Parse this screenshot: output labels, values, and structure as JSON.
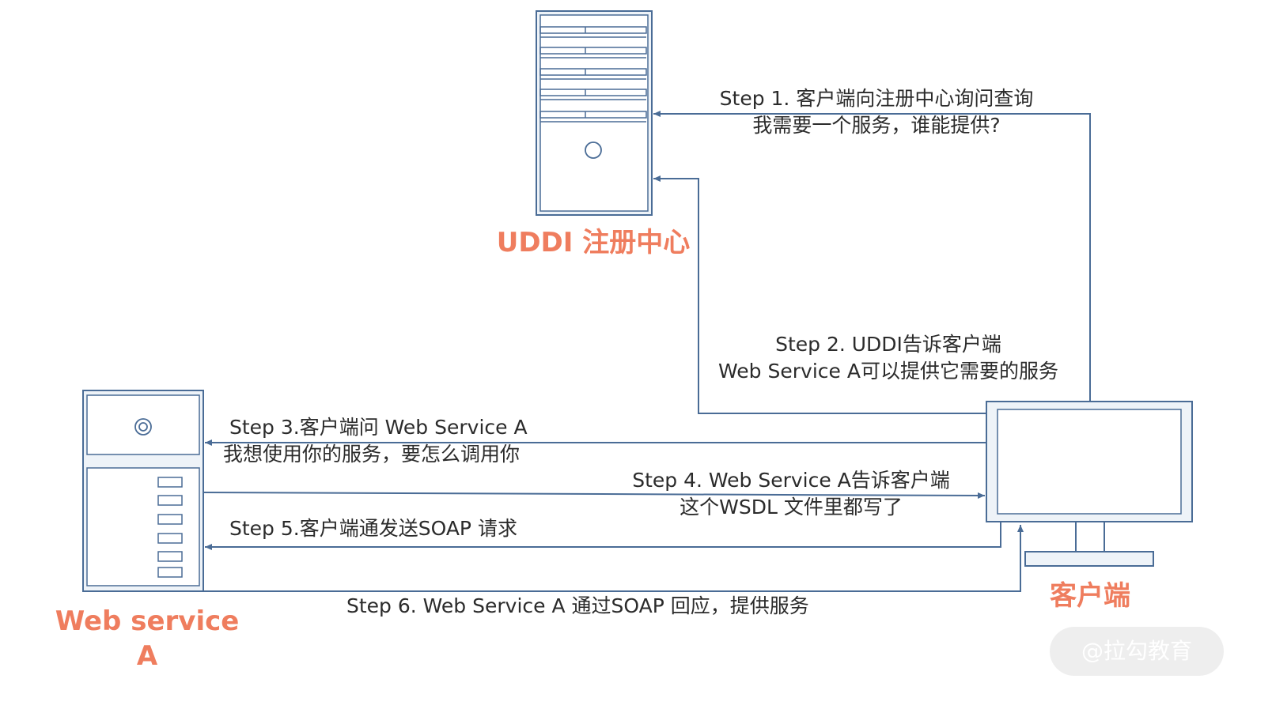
{
  "colors": {
    "line": "#4a6c96",
    "frame_fill": "#eef3f8",
    "title": "#ef7d5e",
    "text": "#2b2b2b",
    "watermark_bg": "#eeeeee"
  },
  "nodes": {
    "uddi": {
      "title": "UDDI 注册中心"
    },
    "webservice": {
      "title_line1": "Web service",
      "title_line2": "A"
    },
    "client": {
      "title": "客户端"
    }
  },
  "steps": {
    "step1": {
      "line1": "Step 1. 客户端向注册中心询问查询",
      "line2": "我需要一个服务，谁能提供?"
    },
    "step2": {
      "line1": "Step 2. UDDI告诉客户端",
      "line2": "Web Service A可以提供它需要的服务"
    },
    "step3": {
      "line1": "Step 3.客户端问 Web Service A",
      "line2": "我想使用你的服务，要怎么调用你"
    },
    "step4": {
      "line1": "Step 4. Web Service A告诉客户端",
      "line2": "这个WSDL 文件里都写了"
    },
    "step5": {
      "line1": "Step 5.客户端通发送SOAP 请求"
    },
    "step6": {
      "line1": "Step 6. Web Service A 通过SOAP 回应，提供服务"
    }
  },
  "watermark": {
    "text": "@拉勾教育"
  }
}
